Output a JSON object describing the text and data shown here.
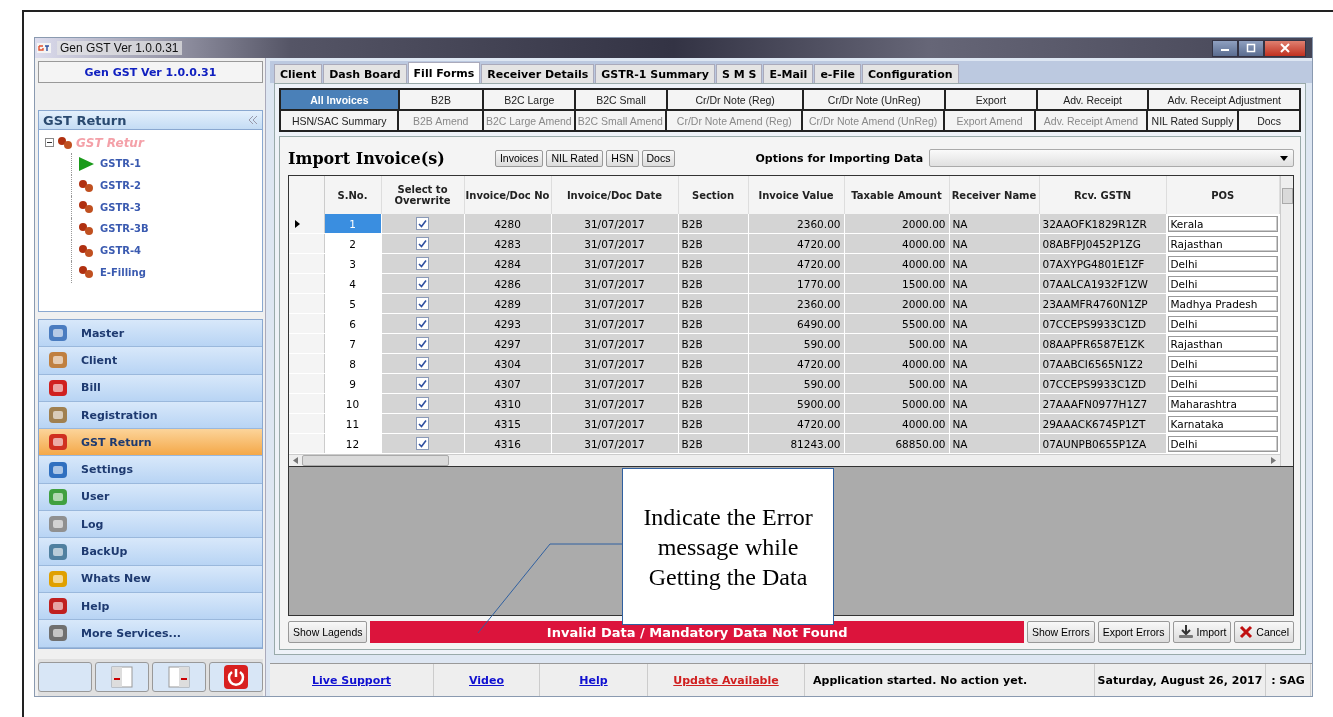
{
  "window": {
    "title": "Gen GST  Ver 1.0.0.31"
  },
  "sidebar": {
    "app_label": "Gen GST  Ver 1.0.0.31",
    "panel_title": "GST Return",
    "tree": {
      "label": "GST Retur",
      "expanded": true,
      "children": [
        {
          "label": "GSTR-1",
          "selected": true
        },
        {
          "label": "GSTR-2",
          "selected": false
        },
        {
          "label": "GSTR-3",
          "selected": false
        },
        {
          "label": "GSTR-3B",
          "selected": false
        },
        {
          "label": "GSTR-4",
          "selected": false
        },
        {
          "label": "E-Filling",
          "selected": false
        }
      ]
    },
    "nav": [
      {
        "label": "Master",
        "selected": false
      },
      {
        "label": "Client",
        "selected": false
      },
      {
        "label": "Bill",
        "selected": false
      },
      {
        "label": "Registration",
        "selected": false
      },
      {
        "label": "GST Return",
        "selected": true
      },
      {
        "label": "Settings",
        "selected": false
      },
      {
        "label": "User",
        "selected": false
      },
      {
        "label": "Log",
        "selected": false
      },
      {
        "label": "BackUp",
        "selected": false
      },
      {
        "label": "Whats New",
        "selected": false
      },
      {
        "label": "Help",
        "selected": false
      },
      {
        "label": "More Services...",
        "selected": false
      }
    ]
  },
  "tabs": [
    {
      "label": "Client",
      "selected": false
    },
    {
      "label": "Dash Board",
      "selected": false
    },
    {
      "label": "Fill Forms",
      "selected": true
    },
    {
      "label": "Receiver Details",
      "selected": false
    },
    {
      "label": "GSTR-1 Summary",
      "selected": false
    },
    {
      "label": "S M S",
      "selected": false
    },
    {
      "label": "E-Mail",
      "selected": false
    },
    {
      "label": "e-File",
      "selected": false
    },
    {
      "label": "Configuration",
      "selected": false
    }
  ],
  "form_tabs": [
    [
      {
        "label": "All Invoices",
        "selected": true,
        "disabled": false
      },
      {
        "label": "B2B",
        "selected": false,
        "disabled": false
      },
      {
        "label": "B2C Large",
        "selected": false,
        "disabled": false
      },
      {
        "label": "B2C Small",
        "selected": false,
        "disabled": false
      },
      {
        "label": "Cr/Dr Note (Reg)",
        "selected": false,
        "disabled": false
      },
      {
        "label": "Cr/Dr Note (UnReg)",
        "selected": false,
        "disabled": false
      },
      {
        "label": "Export",
        "selected": false,
        "disabled": false
      },
      {
        "label": "Adv. Receipt",
        "selected": false,
        "disabled": false
      },
      {
        "label": "Adv. Receipt Adjustment",
        "selected": false,
        "disabled": false
      }
    ],
    [
      {
        "label": "HSN/SAC Summary",
        "selected": false,
        "disabled": false
      },
      {
        "label": "B2B Amend",
        "selected": false,
        "disabled": true
      },
      {
        "label": "B2C Large Amend",
        "selected": false,
        "disabled": true
      },
      {
        "label": "B2C Small Amend",
        "selected": false,
        "disabled": true
      },
      {
        "label": "Cr/Dr Note Amend (Reg)",
        "selected": false,
        "disabled": true
      },
      {
        "label": "Cr/Dr Note Amend (UnReg)",
        "selected": false,
        "disabled": true
      },
      {
        "label": "Export Amend",
        "selected": false,
        "disabled": true
      },
      {
        "label": "Adv. Receipt Amend",
        "selected": false,
        "disabled": true
      },
      {
        "label": "NIL Rated Supply",
        "selected": false,
        "disabled": false
      },
      {
        "label": "Docs",
        "selected": false,
        "disabled": false
      }
    ]
  ],
  "import": {
    "title": "Import Invoice(s)",
    "type_buttons": [
      "Invoices",
      "NIL Rated",
      "HSN",
      "Docs"
    ],
    "options_label": "Options for Importing Data"
  },
  "table": {
    "columns": [
      "S.No.",
      "Select to Overwrite",
      "Invoice/Doc No",
      "Invoice/Doc Date",
      "Section",
      "Invoice Value",
      "Taxable Amount",
      "Receiver Name",
      "Rcv. GSTN",
      "POS"
    ],
    "rows": [
      {
        "selected": true,
        "sno": "1",
        "overwrite": true,
        "invoice_no": "4280",
        "date": "31/07/2017",
        "section": "B2B",
        "invoice_value": "2360.00",
        "taxable_amount": "2000.00",
        "receiver_name": "NA",
        "rcv_gstn": "32AAOFK1829R1ZR",
        "pos": "Kerala"
      },
      {
        "selected": false,
        "sno": "2",
        "overwrite": true,
        "invoice_no": "4283",
        "date": "31/07/2017",
        "section": "B2B",
        "invoice_value": "4720.00",
        "taxable_amount": "4000.00",
        "receiver_name": "NA",
        "rcv_gstn": "08ABFPJ0452P1ZG",
        "pos": "Rajasthan"
      },
      {
        "selected": false,
        "sno": "3",
        "overwrite": true,
        "invoice_no": "4284",
        "date": "31/07/2017",
        "section": "B2B",
        "invoice_value": "4720.00",
        "taxable_amount": "4000.00",
        "receiver_name": "NA",
        "rcv_gstn": "07AXYPG4801E1ZF",
        "pos": "Delhi"
      },
      {
        "selected": false,
        "sno": "4",
        "overwrite": true,
        "invoice_no": "4286",
        "date": "31/07/2017",
        "section": "B2B",
        "invoice_value": "1770.00",
        "taxable_amount": "1500.00",
        "receiver_name": "NA",
        "rcv_gstn": "07AALCA1932F1ZW",
        "pos": "Delhi"
      },
      {
        "selected": false,
        "sno": "5",
        "overwrite": true,
        "invoice_no": "4289",
        "date": "31/07/2017",
        "section": "B2B",
        "invoice_value": "2360.00",
        "taxable_amount": "2000.00",
        "receiver_name": "NA",
        "rcv_gstn": "23AAMFR4760N1ZP",
        "pos": "Madhya Pradesh"
      },
      {
        "selected": false,
        "sno": "6",
        "overwrite": true,
        "invoice_no": "4293",
        "date": "31/07/2017",
        "section": "B2B",
        "invoice_value": "6490.00",
        "taxable_amount": "5500.00",
        "receiver_name": "NA",
        "rcv_gstn": "07CCEPS9933C1ZD",
        "pos": "Delhi"
      },
      {
        "selected": false,
        "sno": "7",
        "overwrite": true,
        "invoice_no": "4297",
        "date": "31/07/2017",
        "section": "B2B",
        "invoice_value": "590.00",
        "taxable_amount": "500.00",
        "receiver_name": "NA",
        "rcv_gstn": "08AAPFR6587E1ZK",
        "pos": "Rajasthan"
      },
      {
        "selected": false,
        "sno": "8",
        "overwrite": true,
        "invoice_no": "4304",
        "date": "31/07/2017",
        "section": "B2B",
        "invoice_value": "4720.00",
        "taxable_amount": "4000.00",
        "receiver_name": "NA",
        "rcv_gstn": "07AABCI6565N1Z2",
        "pos": "Delhi"
      },
      {
        "selected": false,
        "sno": "9",
        "overwrite": true,
        "invoice_no": "4307",
        "date": "31/07/2017",
        "section": "B2B",
        "invoice_value": "590.00",
        "taxable_amount": "500.00",
        "receiver_name": "NA",
        "rcv_gstn": "07CCEPS9933C1ZD",
        "pos": "Delhi"
      },
      {
        "selected": false,
        "sno": "10",
        "overwrite": true,
        "invoice_no": "4310",
        "date": "31/07/2017",
        "section": "B2B",
        "invoice_value": "5900.00",
        "taxable_amount": "5000.00",
        "receiver_name": "NA",
        "rcv_gstn": "27AAAFN0977H1Z7",
        "pos": "Maharashtra"
      },
      {
        "selected": false,
        "sno": "11",
        "overwrite": true,
        "invoice_no": "4315",
        "date": "31/07/2017",
        "section": "B2B",
        "invoice_value": "4720.00",
        "taxable_amount": "4000.00",
        "receiver_name": "NA",
        "rcv_gstn": "29AAACK6745P1ZT",
        "pos": "Karnataka"
      },
      {
        "selected": false,
        "sno": "12",
        "overwrite": true,
        "invoice_no": "4316",
        "date": "31/07/2017",
        "section": "B2B",
        "invoice_value": "81243.00",
        "taxable_amount": "68850.00",
        "receiver_name": "NA",
        "rcv_gstn": "07AUNPB0655P1ZA",
        "pos": "Delhi"
      }
    ]
  },
  "action_bar": {
    "legends_button": "Show Lagends",
    "error_message": "Invalid Data / Mandatory Data Not Found",
    "buttons": [
      "Show Errors",
      "Export Errors",
      "Import",
      "Cancel"
    ]
  },
  "status_bar": {
    "links": [
      {
        "label": "Live Support",
        "kind": "normal"
      },
      {
        "label": "Video",
        "kind": "normal"
      },
      {
        "label": "Help",
        "kind": "normal"
      },
      {
        "label": "Update Available",
        "kind": "alert"
      }
    ],
    "message": "Application started. No action yet.",
    "date": "Saturday, August 26, 2017",
    "user": ": SAG"
  },
  "callout": {
    "text": "Indicate the Error message while Getting the Data"
  }
}
